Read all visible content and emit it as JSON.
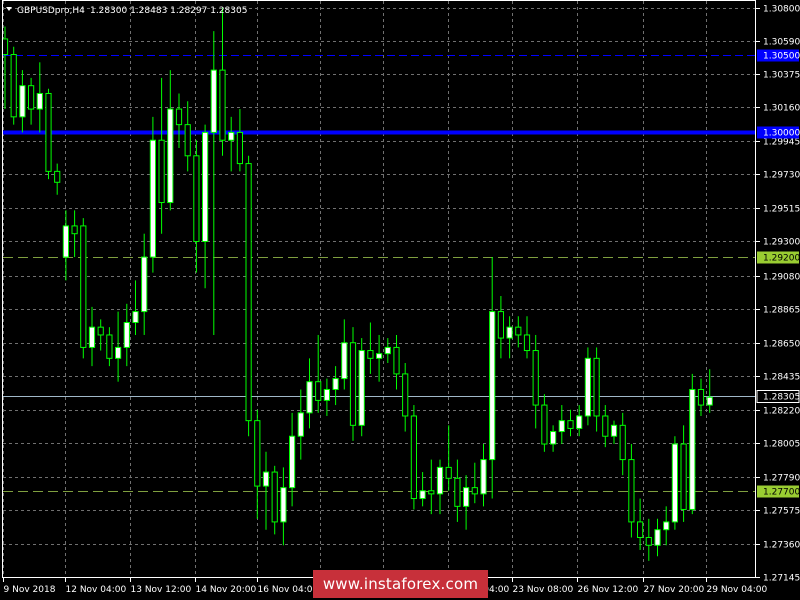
{
  "header": {
    "symbol": "GBPUSDpro,H4",
    "ohlc": "1.28300 1.28483 1.28297 1.28305"
  },
  "watermark": "www.instaforex.com",
  "colors": {
    "background": "#000000",
    "bull_body": "#ffffff",
    "wick": "#00ff00",
    "blue_line": "#0000ff",
    "support_line": "#7f9f3f",
    "current_price_line": "#a0b8c8"
  },
  "chart_data": {
    "type": "candlestick",
    "title": "GBPUSDpro,H4",
    "x_tick_labels": [
      "9 Nov 2018",
      "12 Nov 04:00",
      "13 Nov 12:00",
      "14 Nov 20:00",
      "16 Nov 04:00",
      "19 Nov 12:00",
      "20 Nov 20:00",
      "22 Nov 04:00",
      "23 Nov 08:00",
      "26 Nov 12:00",
      "27 Nov 20:00",
      "29 Nov 04:00"
    ],
    "y_tick_labels": [
      "1.30800",
      "1.30590",
      "1.30375",
      "1.30160",
      "1.29945",
      "1.29730",
      "1.29515",
      "1.29300",
      "1.29080",
      "1.28865",
      "1.28650",
      "1.28435",
      "1.28220",
      "1.28005",
      "1.27790",
      "1.27575",
      "1.27360",
      "1.27145"
    ],
    "ylim": [
      1.2714,
      1.3085
    ],
    "levels": [
      {
        "value": 1.305,
        "label": "1.30500",
        "style": "dashed-blue"
      },
      {
        "value": 1.3,
        "label": "1.30000",
        "style": "solid-blue-thick"
      },
      {
        "value": 1.292,
        "label": "1.29200",
        "style": "dashed-olive"
      },
      {
        "value": 1.277,
        "label": "1.27700",
        "style": "dashed-olive"
      },
      {
        "value": 1.28305,
        "label": "1.28305",
        "style": "current-price"
      }
    ],
    "candles": [
      [
        1.306,
        1.3068,
        1.3015,
        1.305
      ],
      [
        1.305,
        1.3055,
        1.3005,
        1.301
      ],
      [
        1.301,
        1.304,
        1.3,
        1.303
      ],
      [
        1.303,
        1.3035,
        1.3005,
        1.3015
      ],
      [
        1.3015,
        1.3045,
        1.3,
        1.3025
      ],
      [
        1.3025,
        1.3028,
        1.297,
        1.2975
      ],
      [
        1.2975,
        1.298,
        1.296,
        1.2968
      ],
      [
        1.292,
        1.295,
        1.2905,
        1.294
      ],
      [
        1.294,
        1.295,
        1.292,
        1.2935
      ],
      [
        1.294,
        1.2945,
        1.2855,
        1.2862
      ],
      [
        1.2862,
        1.2888,
        1.285,
        1.2875
      ],
      [
        1.2875,
        1.288,
        1.286,
        1.287
      ],
      [
        1.287,
        1.2875,
        1.285,
        1.2855
      ],
      [
        1.2855,
        1.2885,
        1.284,
        1.2862
      ],
      [
        1.2862,
        1.289,
        1.285,
        1.2878
      ],
      [
        1.2878,
        1.2905,
        1.287,
        1.2885
      ],
      [
        1.2885,
        1.2935,
        1.287,
        1.292
      ],
      [
        1.292,
        1.301,
        1.291,
        1.2995
      ],
      [
        1.2995,
        1.3035,
        1.2935,
        1.2955
      ],
      [
        1.2955,
        1.304,
        1.295,
        1.3015
      ],
      [
        1.3015,
        1.3025,
        1.299,
        1.3005
      ],
      [
        1.3005,
        1.302,
        1.2975,
        1.2985
      ],
      [
        1.2985,
        1.2995,
        1.291,
        1.293
      ],
      [
        1.293,
        1.3005,
        1.29,
        1.3
      ],
      [
        1.3,
        1.3065,
        1.287,
        1.304
      ],
      [
        1.304,
        1.308,
        1.2985,
        1.2995
      ],
      [
        1.2995,
        1.301,
        1.2975,
        1.3
      ],
      [
        1.3,
        1.3015,
        1.2975,
        1.298
      ],
      [
        1.298,
        1.2985,
        1.2805,
        1.2815
      ],
      [
        1.2815,
        1.2822,
        1.2752,
        1.2773
      ],
      [
        1.2773,
        1.2795,
        1.2745,
        1.2782
      ],
      [
        1.2782,
        1.2786,
        1.2742,
        1.275
      ],
      [
        1.275,
        1.2785,
        1.2735,
        1.2772
      ],
      [
        1.2772,
        1.282,
        1.276,
        1.2805
      ],
      [
        1.2805,
        1.2835,
        1.279,
        1.282
      ],
      [
        1.282,
        1.2855,
        1.281,
        1.284
      ],
      [
        1.284,
        1.287,
        1.282,
        1.2828
      ],
      [
        1.2828,
        1.2842,
        1.2818,
        1.2835
      ],
      [
        1.2835,
        1.285,
        1.2825,
        1.2842
      ],
      [
        1.2842,
        1.288,
        1.2835,
        1.2865
      ],
      [
        1.2865,
        1.2875,
        1.2802,
        1.2812
      ],
      [
        1.2812,
        1.2868,
        1.2805,
        1.286
      ],
      [
        1.286,
        1.2878,
        1.2845,
        1.2855
      ],
      [
        1.2855,
        1.287,
        1.284,
        1.2858
      ],
      [
        1.2858,
        1.2868,
        1.2852,
        1.2862
      ],
      [
        1.2862,
        1.287,
        1.2835,
        1.2845
      ],
      [
        1.2845,
        1.2852,
        1.2808,
        1.2818
      ],
      [
        1.2818,
        1.2825,
        1.2758,
        1.2765
      ],
      [
        1.2765,
        1.2782,
        1.276,
        1.277
      ],
      [
        1.277,
        1.279,
        1.2755,
        1.2768
      ],
      [
        1.2768,
        1.279,
        1.2755,
        1.2785
      ],
      [
        1.2785,
        1.2812,
        1.277,
        1.2778
      ],
      [
        1.2778,
        1.279,
        1.275,
        1.276
      ],
      [
        1.276,
        1.278,
        1.2745,
        1.2772
      ],
      [
        1.2772,
        1.2788,
        1.2762,
        1.2768
      ],
      [
        1.2768,
        1.28,
        1.276,
        1.279
      ],
      [
        1.279,
        1.292,
        1.2765,
        1.2885
      ],
      [
        1.2885,
        1.2895,
        1.2855,
        1.2868
      ],
      [
        1.2868,
        1.2882,
        1.2855,
        1.2875
      ],
      [
        1.2875,
        1.2882,
        1.2862,
        1.287
      ],
      [
        1.287,
        1.2882,
        1.2855,
        1.286
      ],
      [
        1.286,
        1.287,
        1.281,
        1.2825
      ],
      [
        1.2825,
        1.2832,
        1.2795,
        1.28
      ],
      [
        1.28,
        1.2812,
        1.2795,
        1.2808
      ],
      [
        1.2808,
        1.2825,
        1.28,
        1.2815
      ],
      [
        1.2815,
        1.2822,
        1.2805,
        1.281
      ],
      [
        1.281,
        1.2825,
        1.2805,
        1.2818
      ],
      [
        1.2818,
        1.2862,
        1.2812,
        1.2855
      ],
      [
        1.2855,
        1.2862,
        1.2808,
        1.2818
      ],
      [
        1.2818,
        1.2825,
        1.2798,
        1.2805
      ],
      [
        1.2805,
        1.2815,
        1.28,
        1.2812
      ],
      [
        1.2812,
        1.282,
        1.278,
        1.279
      ],
      [
        1.279,
        1.28,
        1.274,
        1.275
      ],
      [
        1.275,
        1.2765,
        1.2732,
        1.274
      ],
      [
        1.274,
        1.2752,
        1.2725,
        1.2735
      ],
      [
        1.2735,
        1.2752,
        1.2728,
        1.2745
      ],
      [
        1.2745,
        1.276,
        1.2735,
        1.275
      ],
      [
        1.275,
        1.2805,
        1.2745,
        1.28
      ],
      [
        1.28,
        1.2812,
        1.275,
        1.2758
      ],
      [
        1.2758,
        1.2845,
        1.2755,
        1.2835
      ],
      [
        1.2835,
        1.2842,
        1.2818,
        1.2825
      ],
      [
        1.2825,
        1.2848,
        1.282,
        1.283
      ]
    ]
  }
}
